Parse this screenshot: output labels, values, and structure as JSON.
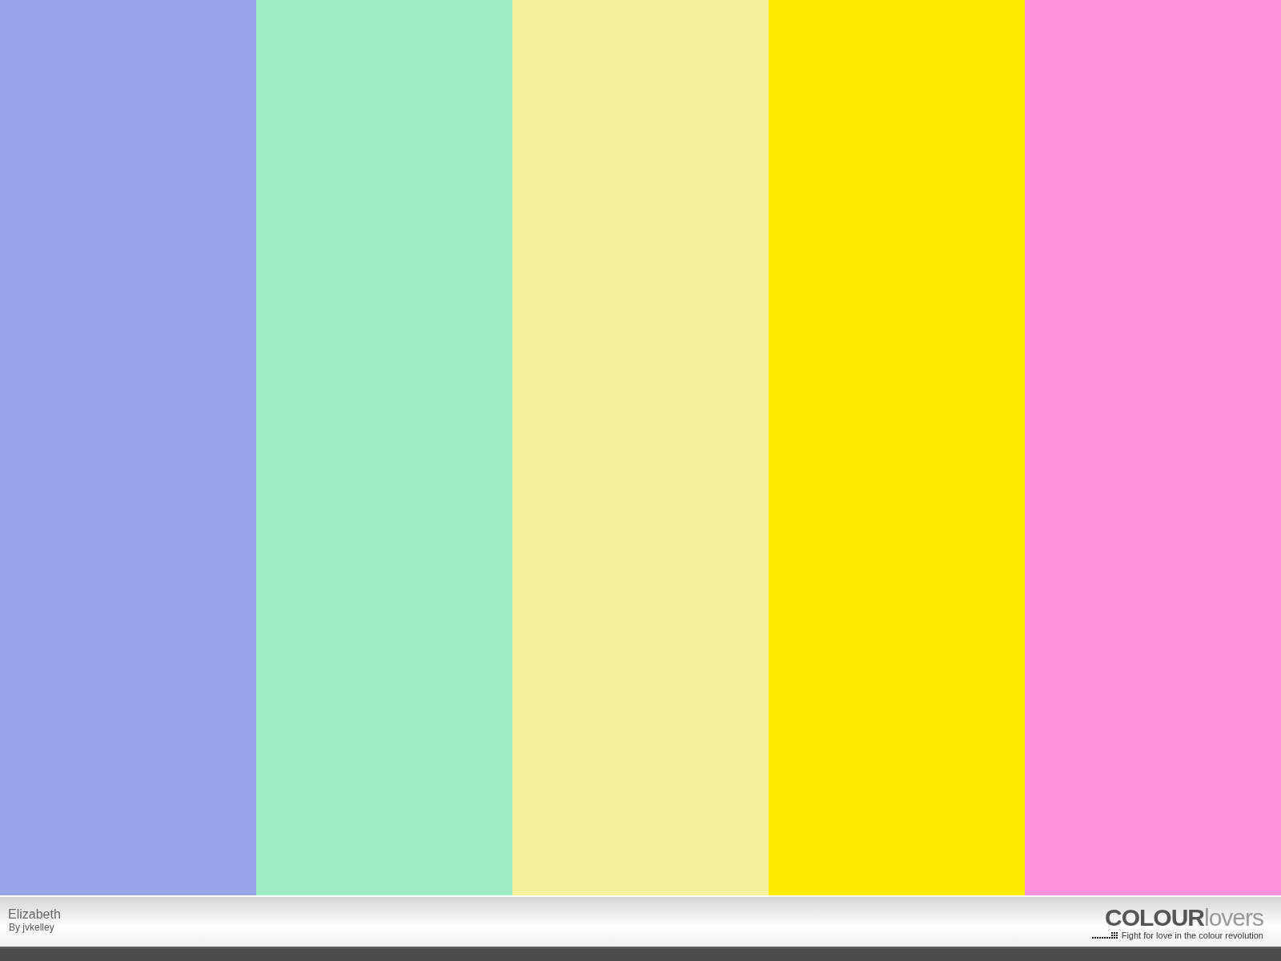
{
  "palette": {
    "swatches": [
      {
        "color": "#9aa4ea"
      },
      {
        "color": "#9eedc3"
      },
      {
        "color": "#f6f09d"
      },
      {
        "color": "#ffea00"
      },
      {
        "color": "#ff91dd"
      }
    ]
  },
  "footer": {
    "title": "Elizabeth",
    "author": "By jvkelley",
    "logo": {
      "strong": "COLOUR",
      "light": "lovers"
    },
    "tagline": "Fight for love in the colour revolution"
  }
}
